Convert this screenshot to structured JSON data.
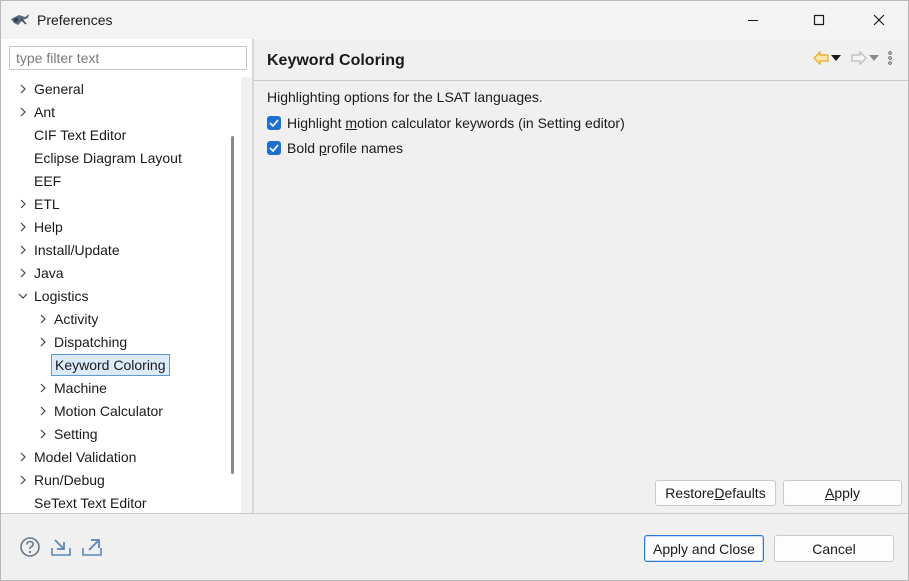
{
  "window": {
    "title": "Preferences"
  },
  "filter": {
    "placeholder": "type filter text"
  },
  "tree": {
    "items": [
      {
        "label": "General",
        "expander": "collapsed",
        "level": 0
      },
      {
        "label": "Ant",
        "expander": "collapsed",
        "level": 0
      },
      {
        "label": "CIF Text Editor",
        "expander": "none",
        "level": 0
      },
      {
        "label": "Eclipse Diagram Layout",
        "expander": "none",
        "level": 0
      },
      {
        "label": "EEF",
        "expander": "none",
        "level": 0
      },
      {
        "label": "ETL",
        "expander": "collapsed",
        "level": 0
      },
      {
        "label": "Help",
        "expander": "collapsed",
        "level": 0
      },
      {
        "label": "Install/Update",
        "expander": "collapsed",
        "level": 0
      },
      {
        "label": "Java",
        "expander": "collapsed",
        "level": 0
      },
      {
        "label": "Logistics",
        "expander": "expanded",
        "level": 0
      },
      {
        "label": "Activity",
        "expander": "collapsed",
        "level": 1
      },
      {
        "label": "Dispatching",
        "expander": "collapsed",
        "level": 1
      },
      {
        "label": "Keyword Coloring",
        "expander": "none",
        "level": 1,
        "selected": true
      },
      {
        "label": "Machine",
        "expander": "collapsed",
        "level": 1
      },
      {
        "label": "Motion Calculator",
        "expander": "collapsed",
        "level": 1
      },
      {
        "label": "Setting",
        "expander": "collapsed",
        "level": 1
      },
      {
        "label": "Model Validation",
        "expander": "collapsed",
        "level": 0
      },
      {
        "label": "Run/Debug",
        "expander": "collapsed",
        "level": 0
      },
      {
        "label": "SeText Text Editor",
        "expander": "none",
        "level": 0
      }
    ]
  },
  "page": {
    "title": "Keyword Coloring",
    "description": "Highlighting options for the LSAT languages.",
    "options": [
      {
        "pre": "Highlight ",
        "mnemonic": "m",
        "post": "otion calculator keywords (in Setting editor)",
        "checked": true
      },
      {
        "pre": "Bold ",
        "mnemonic": "p",
        "post": "rofile names",
        "checked": true
      }
    ],
    "restore_defaults": {
      "pre": "Restore ",
      "mnemonic": "D",
      "post": "efaults"
    },
    "apply": {
      "pre": "",
      "mnemonic": "A",
      "post": "pply"
    }
  },
  "footer": {
    "apply_and_close": "Apply and Close",
    "cancel": "Cancel"
  },
  "icons": {
    "back": "back-arrow-icon",
    "forward": "forward-arrow-icon",
    "menu": "view-menu-icon",
    "help": "help-icon",
    "import": "import-icon",
    "export": "export-icon"
  },
  "colors": {
    "accent": "#1f6fd1",
    "selection_bg": "#dcebfc",
    "selection_border": "#5e9ad8",
    "back_arrow": "#e8a81f",
    "forward_arrow": "#b8b8b8"
  }
}
